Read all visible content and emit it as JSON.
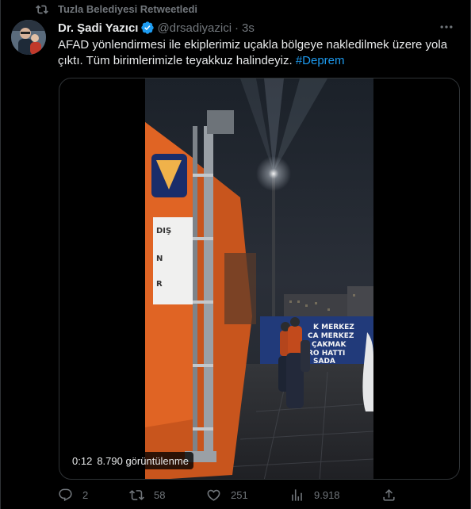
{
  "retweet": {
    "text": "Tuzla Belediyesi Retweetledi"
  },
  "author": {
    "display_name": "Dr. Şadi Yazıcı",
    "handle": "@drsadiyazici",
    "separator": "·",
    "time": "3s"
  },
  "tweet": {
    "text": "AFAD yönlendirmesi ile ekiplerimiz uçakla bölgeye nakledilmek üzere yola çıktı. Tüm birimlerimizle teyakkuz halindeyiz. ",
    "hashtag": "#Deprem"
  },
  "video": {
    "time": "0:12",
    "views": "8.790 görüntülenme",
    "banner_lines": [
      "K MERKEZ",
      "CA MERKEZ",
      "ÇAKMAK",
      "RO HATTI",
      "SADA"
    ],
    "vehicle_text": [
      "DIŞ",
      "N",
      "R"
    ]
  },
  "actions": {
    "replies": "2",
    "retweets": "58",
    "likes": "251",
    "views": "9.918"
  },
  "colors": {
    "background": "#000000",
    "text": "#e7e9ea",
    "muted": "#71767b",
    "accent": "#1d9bf0",
    "vehicle_orange": "#c8551d"
  }
}
